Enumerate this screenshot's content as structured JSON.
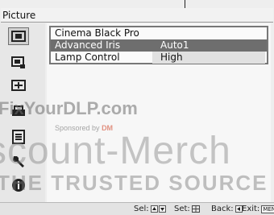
{
  "title": "Picture",
  "sidebar": {
    "items": [
      {
        "icon": "picture-icon",
        "selected": true
      },
      {
        "icon": "picture-adjust-icon",
        "selected": false
      },
      {
        "icon": "screen-icon",
        "selected": false
      },
      {
        "icon": "setup-icon",
        "selected": false
      },
      {
        "icon": "menu-list-icon",
        "selected": false
      },
      {
        "icon": "wrench-icon",
        "selected": false
      },
      {
        "icon": "info-icon",
        "selected": false
      }
    ]
  },
  "menu": {
    "rows": [
      {
        "label": "Cinema Black Pro",
        "value": "",
        "highlighted": false
      },
      {
        "label": "Advanced Iris",
        "value": "Auto1",
        "highlighted": true
      },
      {
        "label": "Lamp Control",
        "value": "High",
        "highlighted": false
      }
    ]
  },
  "footer": {
    "sel_label": "Sel:",
    "set_label": "Set:",
    "back_label": "Back:",
    "exit_label": "Exit:",
    "menu_key": "MENU"
  },
  "watermarks": {
    "site": "FixYourDLP.com",
    "sponsored": "Sponsored by",
    "sponsor_brand": "DM",
    "big": "scount-Merch",
    "tagline": "THE TRUSTED SOURCE FOR"
  },
  "colors": {
    "highlight": "#6e6e6e",
    "background": "#eeeeee"
  }
}
